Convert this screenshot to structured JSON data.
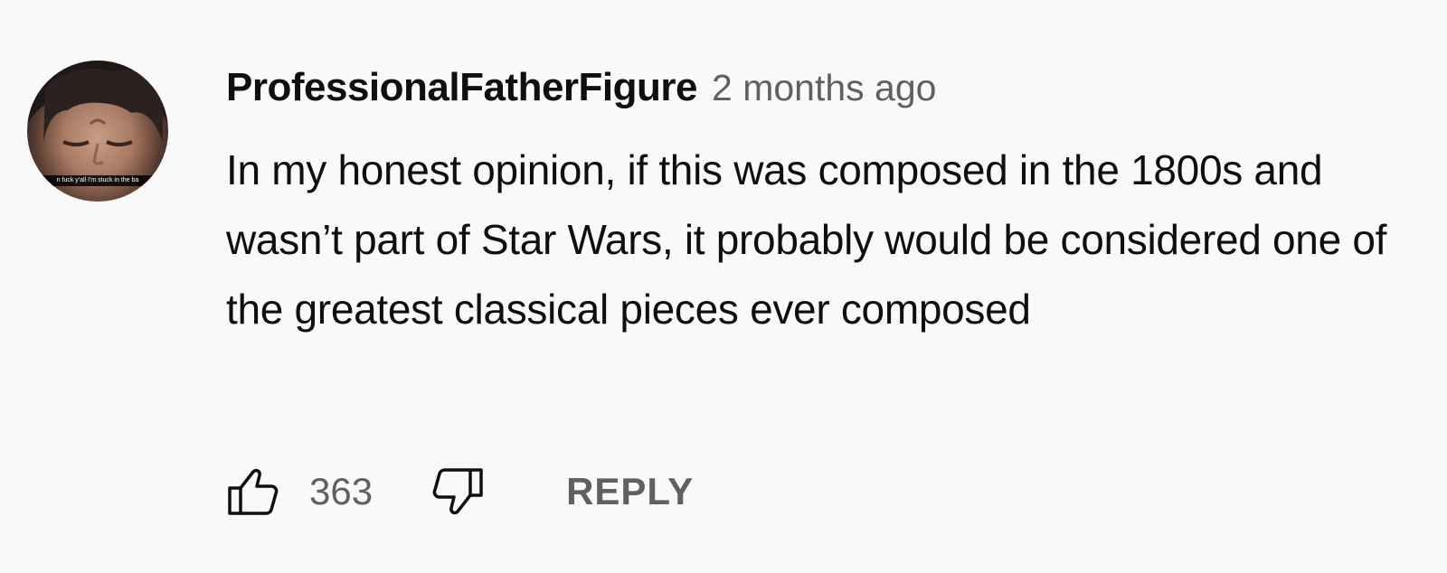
{
  "comment": {
    "author": "ProfessionalFatherFigure",
    "timestamp": "2 months ago",
    "text": "In my honest opinion, if this was composed in the 1800s and wasn’t part of Star Wars, it probably would be considered one of the greatest classical pieces ever composed",
    "avatar_caption": "n fuck y'all I'm stuck in the ba",
    "like_count": "363",
    "reply_label": "REPLY"
  },
  "icons": {
    "like": "thumbs-up-icon",
    "dislike": "thumbs-down-icon"
  },
  "colors": {
    "background": "#f9f9f9",
    "primary_text": "#0f0f0f",
    "secondary_text": "#606060"
  }
}
